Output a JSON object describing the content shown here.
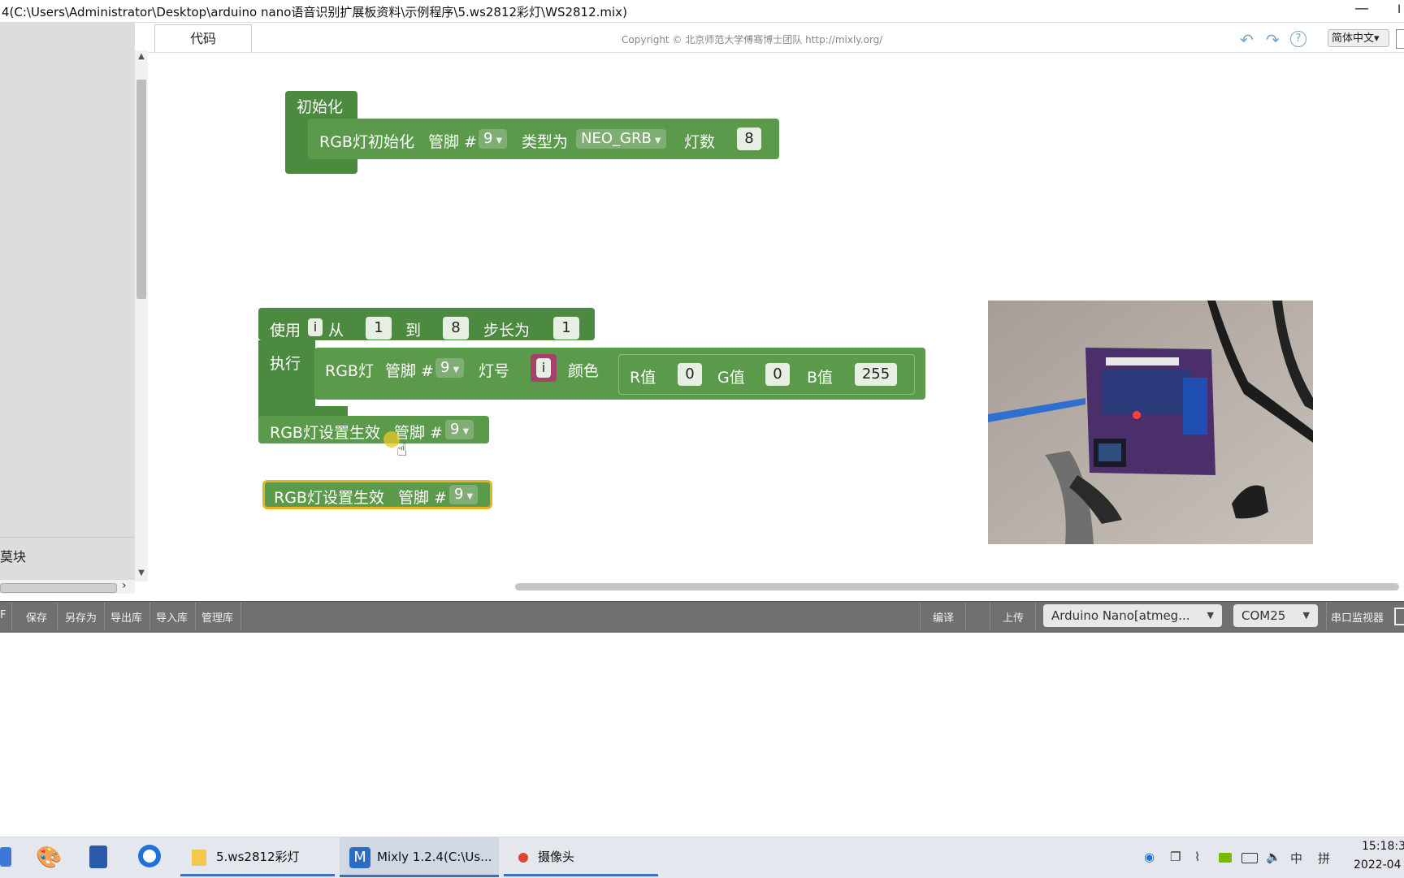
{
  "window": {
    "title": "4(C:\\Users\\Administrator\\Desktop\\arduino nano语音识别扩展板资料\\示例程序\\5.ws2812彩灯\\WS2812.mix)",
    "minimize_glyph": "—",
    "right_fragment": "I"
  },
  "toolbox": {
    "bottom_label": "莫块"
  },
  "header": {
    "code_tab": "代码",
    "copyright": "Copyright © 北京师范大学傅骞博士团队 http://mixly.org/",
    "language": "简体中文▾"
  },
  "blocks": {
    "init": {
      "hat_label": "初始化",
      "rgb_init_label": "RGB灯初始化",
      "pin_label": "管脚 #",
      "pin_value": "9",
      "type_label": "类型为",
      "type_value": "NEO_GRB",
      "count_label": "灯数",
      "count_value": "8"
    },
    "loop": {
      "use_label": "使用",
      "var": "i",
      "from_label": "从",
      "from_value": "1",
      "to_label": "到",
      "to_value": "8",
      "step_label": "步长为",
      "step_value": "1",
      "do_label": "执行",
      "rgb_label": "RGB灯",
      "pin_label": "管脚 #",
      "pin_value": "9",
      "index_label": "灯号",
      "index_var": "i",
      "color_label": "颜色",
      "r_label": "R值",
      "r_value": "0",
      "g_label": "G值",
      "g_value": "0",
      "b_label": "B值",
      "b_value": "255"
    },
    "show1": {
      "label": "RGB灯设置生效",
      "pin_label": "管脚 #",
      "pin_value": "9"
    },
    "show2": {
      "label": "RGB灯设置生效",
      "pin_label": "管脚 #",
      "pin_value": "9"
    }
  },
  "bottombar": {
    "first_fragment": "F",
    "save": "保存",
    "save_as": "另存为",
    "export_lib": "导出库",
    "import_lib": "导入库",
    "manage_lib": "管理库",
    "compile": "编译",
    "upload": "上传",
    "board": "Arduino Nano[atmeg...",
    "port": "COM25",
    "serial_monitor": "串口监视器"
  },
  "taskbar": {
    "folder_app": "5.ws2812彩灯",
    "mixly_app": "Mixly 1.2.4(C:\\Us...",
    "camera_app": "摄像头",
    "ime_lang": "中",
    "ime_mode": "拼",
    "time": "15:18:3",
    "date": "2022-04"
  },
  "colors": {
    "block_dark": "#4c8a3f",
    "block_light": "#5b9a4b",
    "selected_outline": "#e6b422",
    "bottombar": "#707070",
    "taskbar_accent": "#3a6fc4"
  }
}
